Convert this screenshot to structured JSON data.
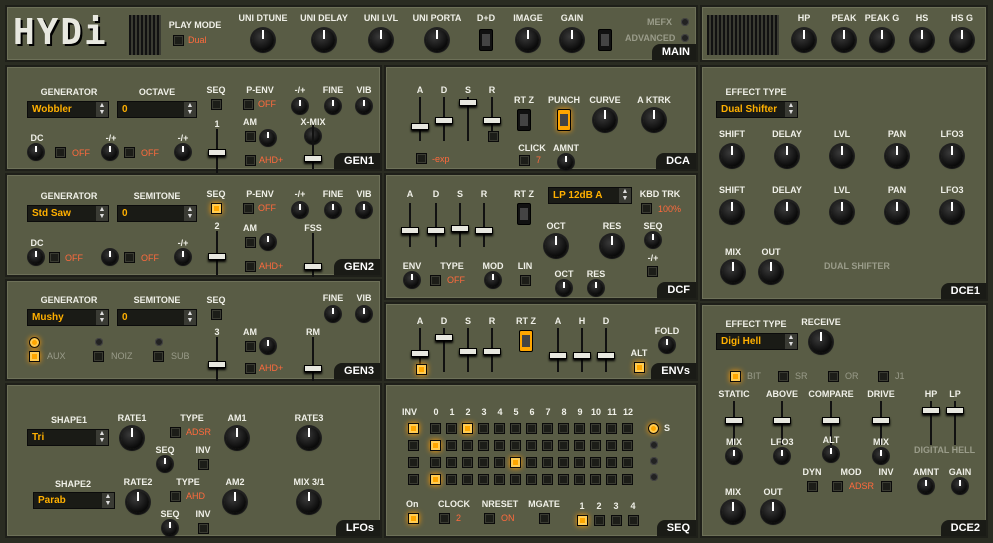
{
  "top": {
    "logo": "HYDi",
    "play_mode": "PLAY MODE",
    "play_mode_val": "Dual",
    "uni_dtune": "UNI DTUNE",
    "uni_delay": "UNI DELAY",
    "uni_lvl": "UNI LVL",
    "uni_porta": "UNI PORTA",
    "dd": "D+D",
    "image": "IMAGE",
    "gain": "GAIN",
    "mefx": "MEFX",
    "advanced": "ADVANCED",
    "main": "MAIN",
    "hp": "HP",
    "peak": "PEAK",
    "peak_g": "PEAK G",
    "hs": "HS",
    "hs_g": "HS G"
  },
  "gen1": {
    "generator": "GENERATOR",
    "octave": "OCTAVE",
    "gen_val": "Wobbler",
    "oct_val": "0",
    "seq": "SEQ",
    "penv": "P-ENV",
    "penv_val": "OFF",
    "pm": "-/+",
    "fine": "FINE",
    "vib": "VIB",
    "dc": "DC",
    "pm2": "-/+",
    "pm3": "-/+",
    "off1": "OFF",
    "off2": "OFF",
    "num": "1",
    "am": "AM",
    "ahd": "AHD+",
    "xmix": "X-MIX",
    "tag": "GEN1"
  },
  "gen2": {
    "generator": "GENERATOR",
    "semitone": "SEMITONE",
    "gen_val": "Std Saw",
    "semi_val": "0",
    "seq": "SEQ",
    "penv": "P-ENV",
    "penv_val": "OFF",
    "pm": "-/+",
    "fine": "FINE",
    "vib": "VIB",
    "dc": "DC",
    "pm2": "-/+",
    "off1": "OFF",
    "off2": "OFF",
    "num": "2",
    "am": "AM",
    "ahd": "AHD+",
    "fss": "FSS",
    "tag": "GEN2"
  },
  "gen3": {
    "generator": "GENERATOR",
    "semitone": "SEMITONE",
    "gen_val": "Mushy",
    "semi_val": "0",
    "seq": "SEQ",
    "fine": "FINE",
    "vib": "VIB",
    "aux": "AUX",
    "noiz": "NOIZ",
    "subl": "SUB",
    "num": "3",
    "am": "AM",
    "ahd": "AHD+",
    "rm": "RM",
    "tag": "GEN3"
  },
  "lfo": {
    "shape1": "SHAPE1",
    "rate1": "RATE1",
    "type1": "TYPE",
    "type1_val": "ADSR",
    "am1": "AM1",
    "rate3": "RATE3",
    "s1_val": "Tri",
    "seq1": "SEQ",
    "inv1": "INV",
    "shape2": "SHAPE2",
    "rate2": "RATE2",
    "type2": "TYPE",
    "type2_val": "AHD",
    "am2": "AM2",
    "mix31": "MIX 3/1",
    "s2_val": "Parab",
    "seq2": "SEQ",
    "inv2": "INV",
    "tag": "LFOs"
  },
  "dca": {
    "a": "A",
    "d": "D",
    "s": "S",
    "r": "R",
    "rtz": "RT Z",
    "punch": "PUNCH",
    "curve": "CURVE",
    "aktrk": "A KTRK",
    "exp": "-exp",
    "click": "CLICK",
    "click_val": "7",
    "amnt": "AMNT",
    "tag": "DCA"
  },
  "dcf": {
    "a": "A",
    "d": "D",
    "s": "S",
    "r": "R",
    "rtz": "RT Z",
    "filter_val": "LP 12dB A",
    "kbd": "KBD TRK",
    "kbd_val": "100%",
    "oct": "OCT",
    "res": "RES",
    "seq": "SEQ",
    "pm": "-/+",
    "env": "ENV",
    "type": "TYPE",
    "type_val": "OFF",
    "mod": "MOD",
    "lin": "LIN",
    "oct2": "OCT",
    "res2": "RES",
    "tag": "DCF"
  },
  "envs": {
    "a": "A",
    "d": "D",
    "s": "S",
    "r": "R",
    "rtz": "RT Z",
    "a2": "A",
    "h": "H",
    "d2": "D",
    "fold": "FOLD",
    "alt": "ALT",
    "tag": "ENVs"
  },
  "seq": {
    "inv": "INV",
    "steps": [
      "0",
      "1",
      "2",
      "3",
      "4",
      "5",
      "6",
      "7",
      "8",
      "9",
      "10",
      "11",
      "12"
    ],
    "s": "S",
    "on": "On",
    "clock": "CLOCK",
    "clock_val": "2",
    "nreset": "NRESET",
    "nreset_val": "ON",
    "mgate": "MGATE",
    "pages": [
      "1",
      "2",
      "3",
      "4"
    ],
    "tag": "SEQ"
  },
  "dce1": {
    "effect_type": "EFFECT TYPE",
    "fx_val": "Dual Shifter",
    "shift": "SHIFT",
    "delay": "DELAY",
    "lvl": "LVL",
    "pan": "PAN",
    "lfo3": "LFO3",
    "mix": "MIX",
    "out": "OUT",
    "name": "DUAL SHIFTER",
    "tag": "DCE1"
  },
  "dce2": {
    "effect_type": "EFFECT TYPE",
    "receive": "RECEIVE",
    "fx_val": "Digi Hell",
    "bit": "BIT",
    "sr": "SR",
    "or": "OR",
    "j1": "J1",
    "static": "STATIC",
    "above": "ABOVE",
    "compare": "COMPARE",
    "drive": "DRIVE",
    "hp": "HP",
    "lp": "LP",
    "mix": "MIX",
    "lfo3": "LFO3",
    "alt": "ALT",
    "mix2": "MIX",
    "name": "DIGITAL HELL",
    "dyn": "DYN",
    "mod": "MOD",
    "inv": "INV",
    "amnt": "AMNT",
    "gain": "GAIN",
    "mix3": "MIX",
    "out": "OUT",
    "mod_val": "ADSR",
    "tag": "DCE2"
  }
}
